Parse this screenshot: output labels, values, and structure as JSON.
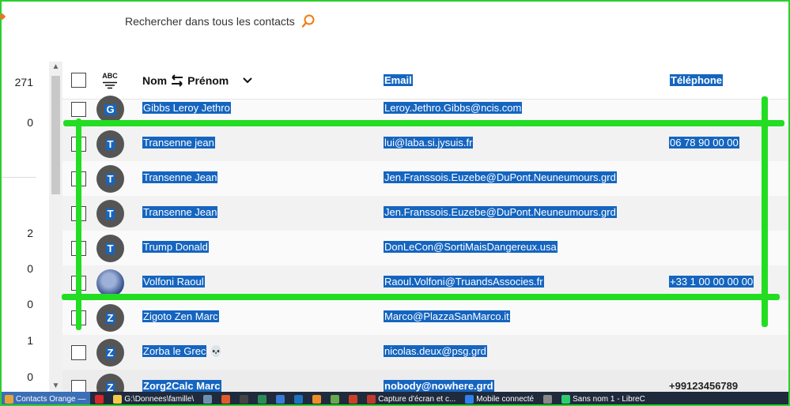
{
  "search": {
    "placeholder": "Rechercher dans tous les contacts"
  },
  "counts": [
    "271",
    "0",
    "2",
    "0",
    "0",
    "1",
    "0"
  ],
  "table": {
    "sort_label": "ABC",
    "col_name_first": "Nom",
    "col_name_second": "Prénom",
    "col_email": "Email",
    "col_phone": "Téléphone"
  },
  "rows": [
    {
      "initial": "G",
      "name": "Gibbs Leroy Jethro",
      "email": "Leroy.Jethro.Gibbs@ncis.com",
      "phone": ""
    },
    {
      "initial": "T",
      "name": "Transenne jean",
      "email": "lui@laba.si.jysuis.fr",
      "phone": "06 78 90 00 00"
    },
    {
      "initial": "T",
      "name": "Transenne Jean",
      "email": "Jen.Franssois.Euzebe@DuPont.Neuneumours.grd",
      "phone": ""
    },
    {
      "initial": "T",
      "name": "Transenne Jean",
      "email": "Jen.Franssois.Euzebe@DuPont.Neuneumours.grd",
      "phone": ""
    },
    {
      "initial": "T",
      "name": "Trump Donald",
      "email": "DonLeCon@SortiMaisDangereux.usa",
      "phone": ""
    },
    {
      "initial": "",
      "name": "Volfoni Raoul",
      "email": "Raoul.Volfoni@TruandsAssocies.fr",
      "phone": "+33 1 00 00 00 00"
    },
    {
      "initial": "Z",
      "name": "Zigoto Zen Marc",
      "email": "Marco@PlazzaSanMarco.it",
      "phone": ""
    },
    {
      "initial": "Z",
      "name": "Zorba le Grec",
      "email": "nicolas.deux@psg.grd",
      "phone": ""
    },
    {
      "initial": "Z",
      "name": "Zorg2Calc Marc",
      "email": "nobody@nowhere.grd",
      "phone": "+99123456789"
    }
  ],
  "taskbar": [
    {
      "label": "Contacts Orange —",
      "color": "#e8a23a"
    },
    {
      "label": "",
      "color": "#d9262c"
    },
    {
      "label": "G:\\Donnees\\famille\\",
      "color": "#f2c94c"
    },
    {
      "label": "",
      "color": "#6f8fb0"
    },
    {
      "label": "",
      "color": "#e05a2b"
    },
    {
      "label": "",
      "color": "#444444"
    },
    {
      "label": "",
      "color": "#2e8b57"
    },
    {
      "label": "",
      "color": "#3a7bd5"
    },
    {
      "label": "",
      "color": "#1e73be"
    },
    {
      "label": "",
      "color": "#f08c2a"
    },
    {
      "label": "",
      "color": "#6aa84f"
    },
    {
      "label": "",
      "color": "#cc4125"
    },
    {
      "label": "Capture d'écran et c...",
      "color": "#c0392b"
    },
    {
      "label": "Mobile connecté",
      "color": "#2f80ed"
    },
    {
      "label": "",
      "color": "#888888"
    },
    {
      "label": "Sans nom 1 - LibreC",
      "color": "#2ecc71"
    }
  ]
}
